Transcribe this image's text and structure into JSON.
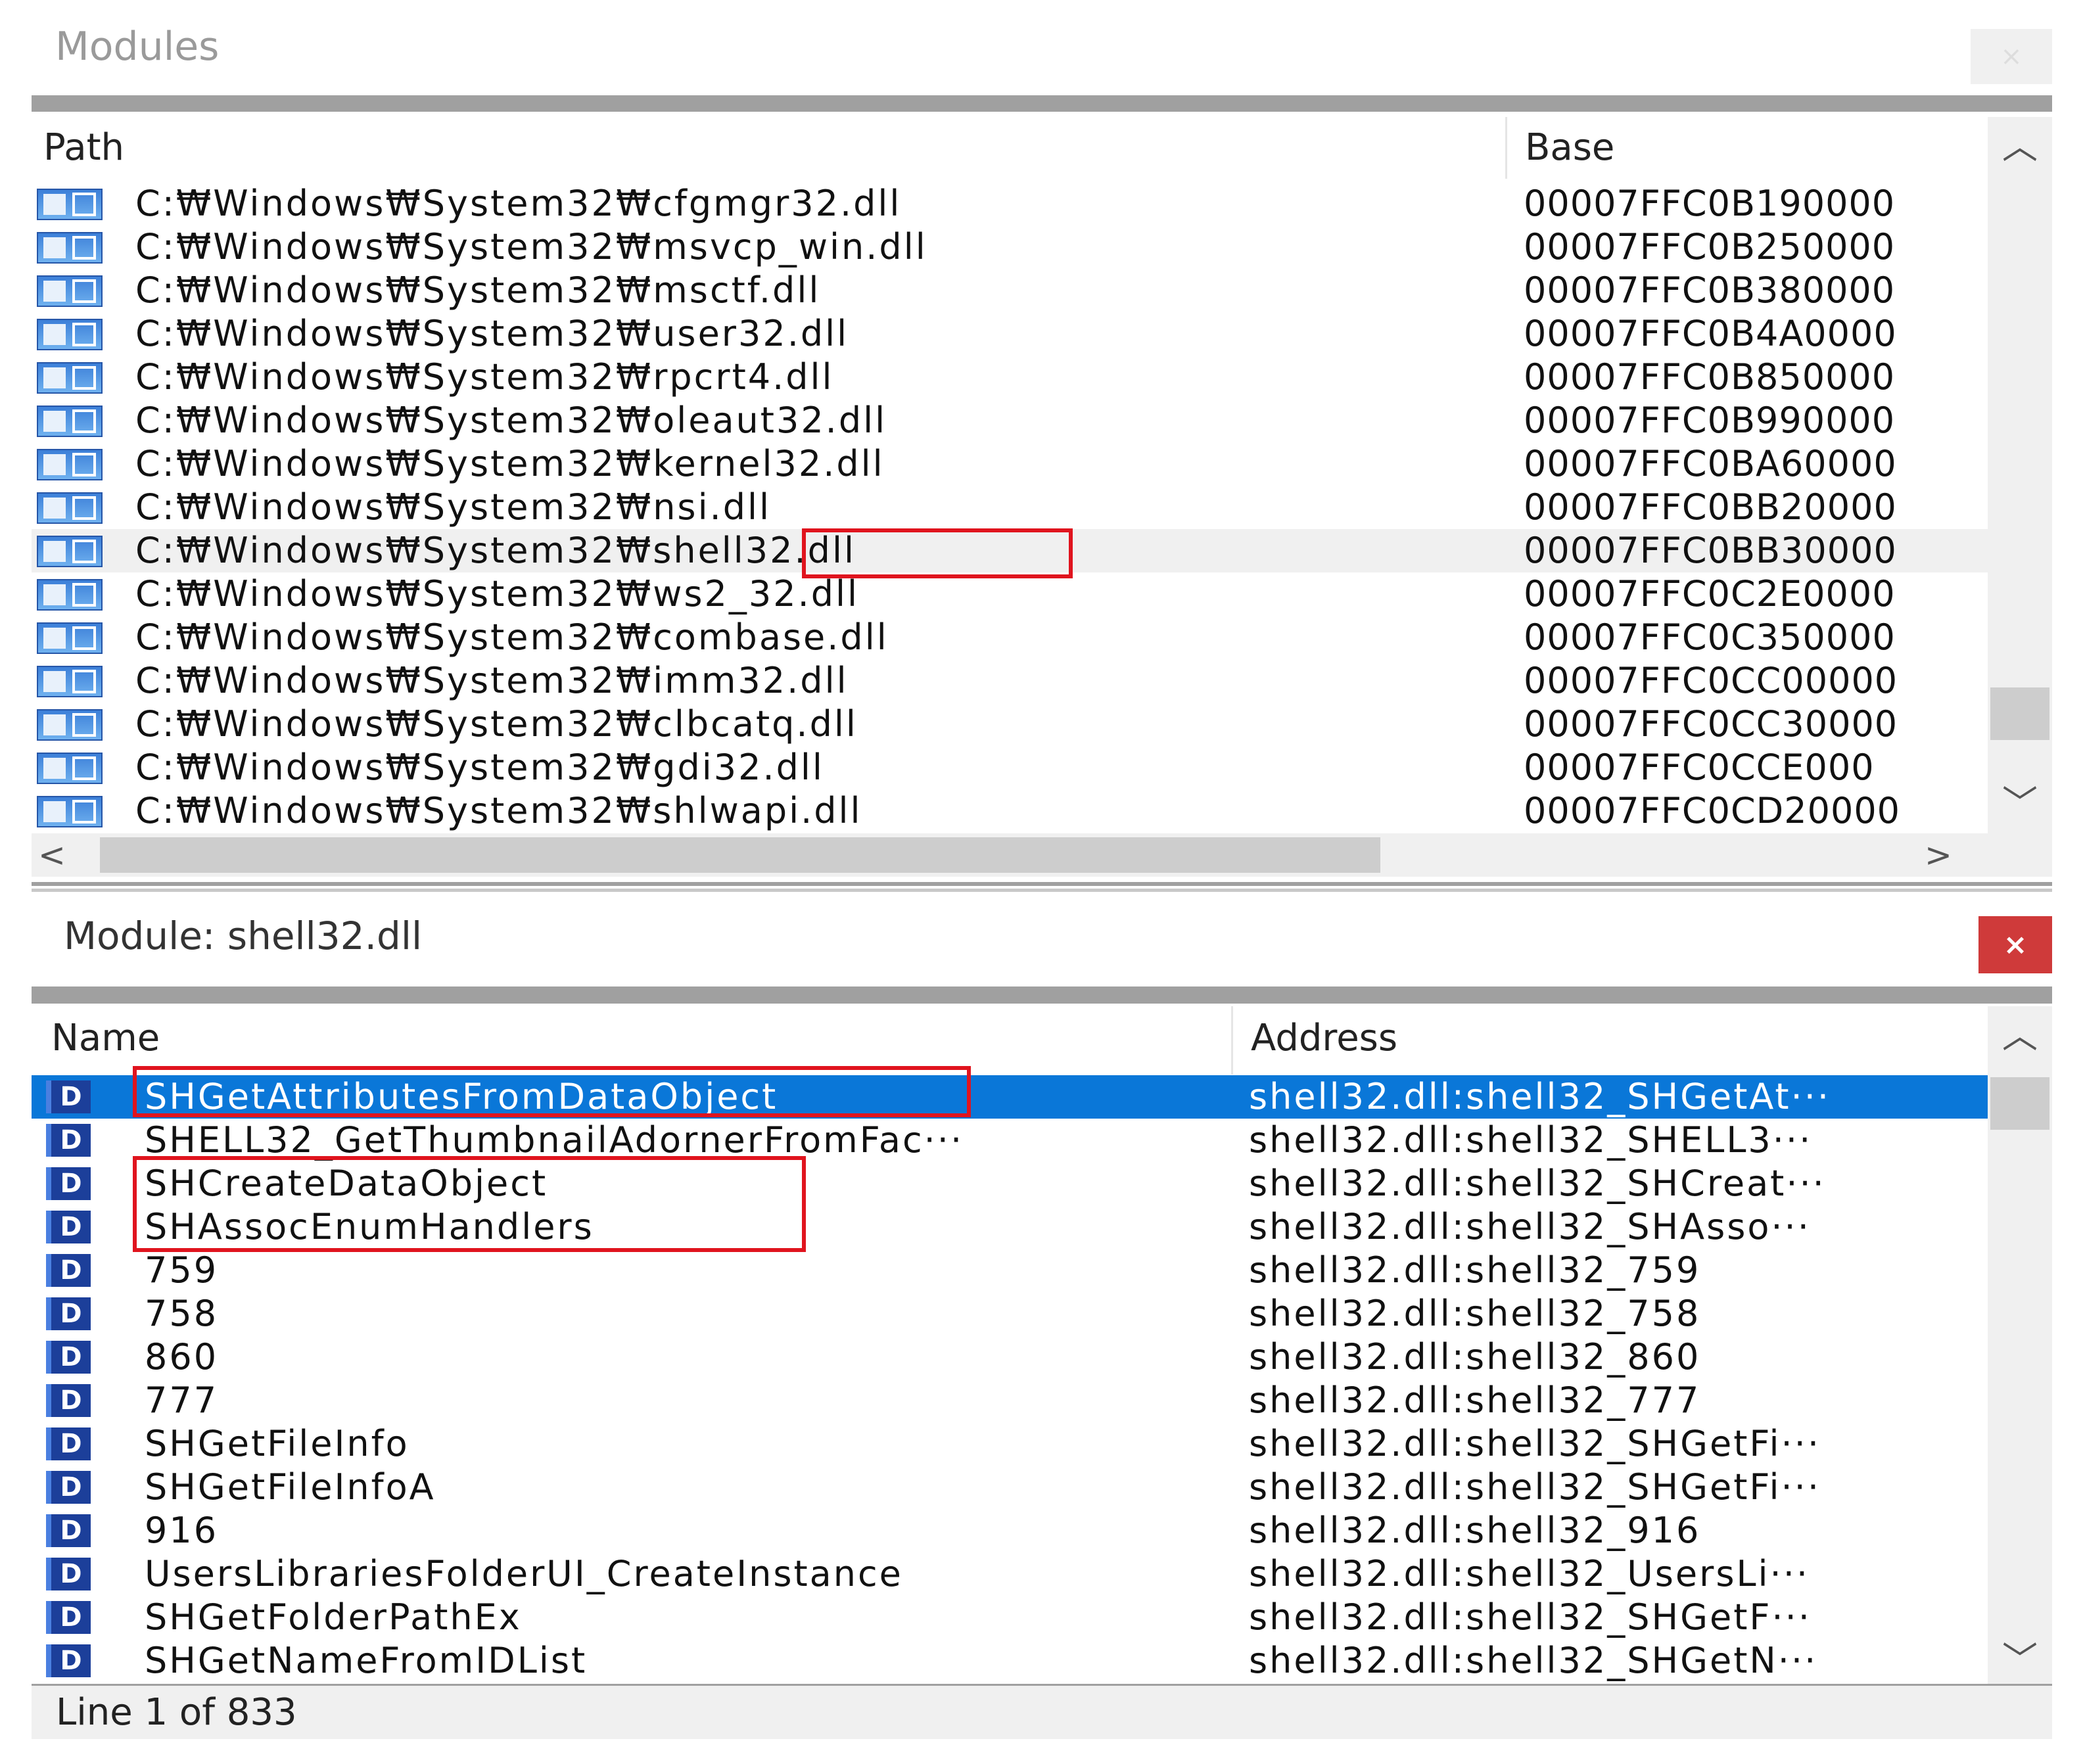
{
  "modules_panel": {
    "title": "Modules",
    "columns": {
      "path": "Path",
      "base": "Base"
    },
    "highlighted_index": 8,
    "rows": [
      {
        "path": "C:₩Windows₩System32₩cfgmgr32.dll",
        "base": "00007FFC0B190000"
      },
      {
        "path": "C:₩Windows₩System32₩msvcp_win.dll",
        "base": "00007FFC0B250000"
      },
      {
        "path": "C:₩Windows₩System32₩msctf.dll",
        "base": "00007FFC0B380000"
      },
      {
        "path": "C:₩Windows₩System32₩user32.dll",
        "base": "00007FFC0B4A0000"
      },
      {
        "path": "C:₩Windows₩System32₩rpcrt4.dll",
        "base": "00007FFC0B850000"
      },
      {
        "path": "C:₩Windows₩System32₩oleaut32.dll",
        "base": "00007FFC0B990000"
      },
      {
        "path": "C:₩Windows₩System32₩kernel32.dll",
        "base": "00007FFC0BA60000"
      },
      {
        "path": "C:₩Windows₩System32₩nsi.dll",
        "base": "00007FFC0BB20000"
      },
      {
        "path": "C:₩Windows₩System32₩shell32.dll",
        "base": "00007FFC0BB30000"
      },
      {
        "path": "C:₩Windows₩System32₩ws2_32.dll",
        "base": "00007FFC0C2E0000"
      },
      {
        "path": "C:₩Windows₩System32₩combase.dll",
        "base": "00007FFC0C350000"
      },
      {
        "path": "C:₩Windows₩System32₩imm32.dll",
        "base": "00007FFC0CC00000"
      },
      {
        "path": "C:₩Windows₩System32₩clbcatq.dll",
        "base": "00007FFC0CC30000"
      },
      {
        "path": "C:₩Windows₩System32₩gdi32.dll",
        "base": "00007FFC0CCE000"
      },
      {
        "path": "C:₩Windows₩System32₩shlwapi.dll",
        "base": "00007FFC0CD20000"
      }
    ]
  },
  "module_panel": {
    "title": "Module: shell32.dll",
    "close_label": "×",
    "columns": {
      "name": "Name",
      "address": "Address"
    },
    "selected_index": 0,
    "rows": [
      {
        "icon": "D",
        "name": "SHGetAttributesFromDataObject",
        "address": "shell32.dll:shell32_SHGetAt···"
      },
      {
        "icon": "D",
        "name": "SHELL32_GetThumbnailAdornerFromFac···",
        "address": "shell32.dll:shell32_SHELL3···"
      },
      {
        "icon": "D",
        "name": "SHCreateDataObject",
        "address": "shell32.dll:shell32_SHCreat···"
      },
      {
        "icon": "D",
        "name": "SHAssocEnumHandlers",
        "address": "shell32.dll:shell32_SHAsso···"
      },
      {
        "icon": "D",
        "name": "759",
        "address": "shell32.dll:shell32_759"
      },
      {
        "icon": "D",
        "name": "758",
        "address": "shell32.dll:shell32_758"
      },
      {
        "icon": "D",
        "name": "860",
        "address": "shell32.dll:shell32_860"
      },
      {
        "icon": "D",
        "name": "777",
        "address": "shell32.dll:shell32_777"
      },
      {
        "icon": "D",
        "name": "SHGetFileInfo",
        "address": "shell32.dll:shell32_SHGetFi···"
      },
      {
        "icon": "D",
        "name": "SHGetFileInfoA",
        "address": "shell32.dll:shell32_SHGetFi···"
      },
      {
        "icon": "D",
        "name": "916",
        "address": "shell32.dll:shell32_916"
      },
      {
        "icon": "D",
        "name": "UsersLibrariesFolderUI_CreateInstance",
        "address": "shell32.dll:shell32_UsersLi···"
      },
      {
        "icon": "D",
        "name": "SHGetFolderPathEx",
        "address": "shell32.dll:shell32_SHGetF···"
      },
      {
        "icon": "D",
        "name": "SHGetNameFromIDList",
        "address": "shell32.dll:shell32_SHGetN···"
      }
    ]
  },
  "status": {
    "text": "Line 1 of 833"
  },
  "colors": {
    "selection": "#0a77d8",
    "annotation": "#e0141e",
    "close": "#cf3a3a"
  }
}
